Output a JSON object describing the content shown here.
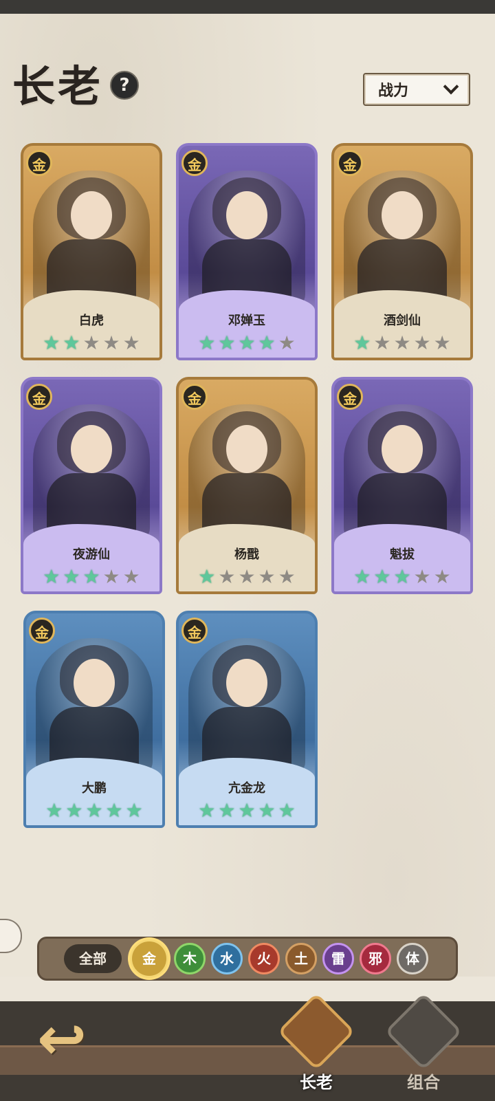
{
  "title": "长老",
  "help": "?",
  "sort": {
    "label": "战力"
  },
  "cards": [
    {
      "name": "白虎",
      "badge": "金",
      "frame": "gold",
      "stars": 2
    },
    {
      "name": "邓婵玉",
      "badge": "金",
      "frame": "purple",
      "stars": 4
    },
    {
      "name": "酒剑仙",
      "badge": "金",
      "frame": "gold",
      "stars": 1
    },
    {
      "name": "夜游仙",
      "badge": "金",
      "frame": "purple",
      "stars": 3
    },
    {
      "name": "杨戬",
      "badge": "金",
      "frame": "gold",
      "stars": 1
    },
    {
      "name": "魁拔",
      "badge": "金",
      "frame": "purple",
      "stars": 3
    },
    {
      "name": "大鹏",
      "badge": "金",
      "frame": "blue",
      "stars": 5
    },
    {
      "name": "亢金龙",
      "badge": "金",
      "frame": "blue",
      "stars": 5
    }
  ],
  "filters": {
    "all": "全部",
    "elements": [
      {
        "label": "金",
        "color": "#c9a13a",
        "border": "#f5d774",
        "active": true
      },
      {
        "label": "木",
        "color": "#3e8e3a",
        "border": "#8fd66a"
      },
      {
        "label": "水",
        "color": "#2f6f9e",
        "border": "#7fc3ee"
      },
      {
        "label": "火",
        "color": "#a73a2c",
        "border": "#f08a62"
      },
      {
        "label": "土",
        "color": "#8a5a2c",
        "border": "#d4a064"
      },
      {
        "label": "雷",
        "color": "#6a3f8e",
        "border": "#c493f0"
      },
      {
        "label": "邪",
        "color": "#a52a3e",
        "border": "#f07a8e"
      },
      {
        "label": "体",
        "color": "#6e6a66",
        "border": "#d8d2c8"
      }
    ]
  },
  "nav": {
    "elder": "长老",
    "combo": "组合"
  },
  "icons": {
    "star": "★",
    "back": "↩"
  }
}
